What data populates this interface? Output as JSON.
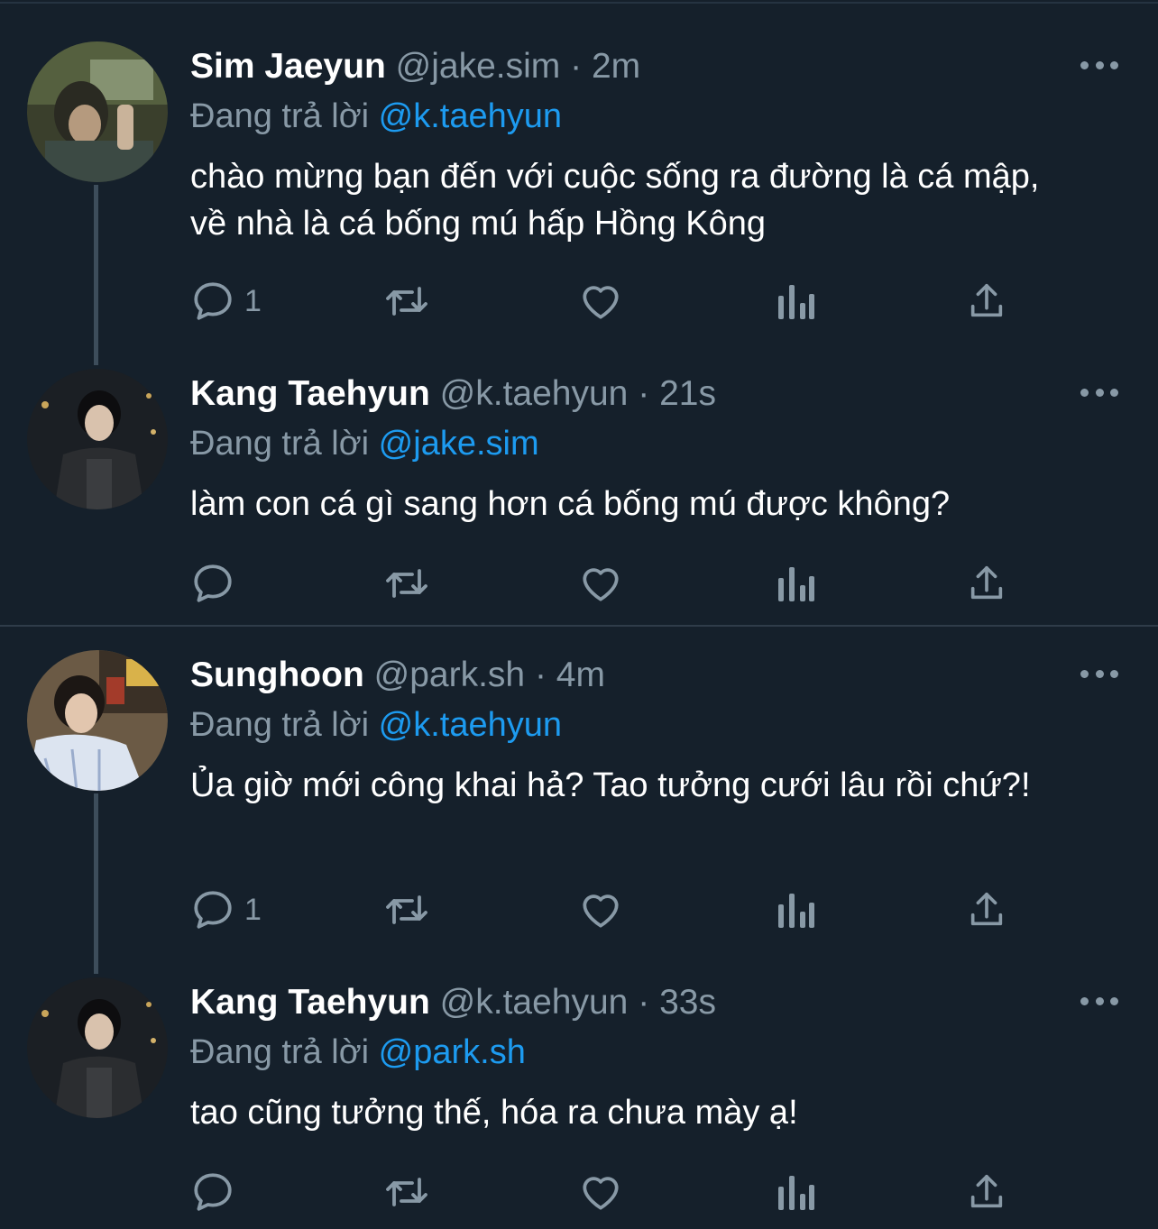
{
  "tweets": [
    {
      "name": "Sim Jaeyun",
      "handle": "@jake.sim",
      "separator": "·",
      "time": "2m",
      "reply_prefix": "Đang trả lời",
      "reply_to": "@k.taehyun",
      "text": "chào mừng bạn đến với cuộc sống ra đường là cá mập, về nhà là cá bống mú hấp Hồng Kông",
      "reply_count": "1"
    },
    {
      "name": "Kang Taehyun",
      "handle": "@k.taehyun",
      "separator": "·",
      "time": "21s",
      "reply_prefix": "Đang trả lời",
      "reply_to": "@jake.sim",
      "text": "làm con cá gì sang hơn cá bống mú được không?",
      "reply_count": ""
    },
    {
      "name": "Sunghoon",
      "handle": "@park.sh",
      "separator": "·",
      "time": "4m",
      "reply_prefix": "Đang trả lời",
      "reply_to": "@k.taehyun",
      "text": "Ủa giờ mới công khai hả? Tao tưởng cưới lâu rồi chứ?!",
      "reply_count": "1"
    },
    {
      "name": "Kang Taehyun",
      "handle": "@k.taehyun",
      "separator": "·",
      "time": "33s",
      "reply_prefix": "Đang trả lời",
      "reply_to": "@park.sh",
      "text": "tao cũng tưởng thế, hóa ra chưa mày ạ!",
      "reply_count": ""
    }
  ],
  "colors": {
    "background": "#15202b",
    "secondary_text": "#8899a6",
    "mention": "#1d9bf0"
  }
}
